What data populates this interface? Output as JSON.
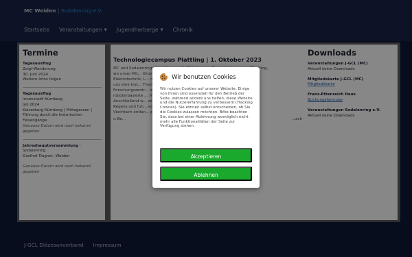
{
  "header": {
    "brand_main": "MC Weiden",
    "brand_sep": "|",
    "brand_sub": "Sodalenring e.V.",
    "nav": [
      {
        "label": "Startseite"
      },
      {
        "label": "Veranstaltungen"
      },
      {
        "label": "Jugendherberge"
      },
      {
        "label": "Chronik"
      }
    ]
  },
  "termine": {
    "title": "Termine",
    "events": [
      {
        "title": "Tagesausflug",
        "lines": [
          "Zoigl-Wanderung",
          "30. Juni 2024",
          "Weitere Infos folgen"
        ]
      },
      {
        "title": "Tagesausflug",
        "lines": [
          "Innenstadt Nürnberg",
          "Juli 2024",
          "Kaiserburg Nürnberg | Mittagessen | Führung durch die historischen Felsengänge"
        ],
        "note": "Genaues Datum wird noch bekannt gegeben"
      },
      {
        "title": "Jahreshauptversammlung",
        "title_suffix": "- Sodalenring",
        "lines": [
          "Gasthof Dagner, Weiden"
        ],
        "note": "Genaues Datum wird noch bekannt gegeben"
      }
    ]
  },
  "article": {
    "title": "Technologiecampus Plattling | 1. Oktober 2023",
    "body_lines": [
      "MC und Sodalenring besuchten am 1. Oktober den Technologiecampus Plattling,",
      "wo unser Mit...                                                    Grundlagen der",
      "Elektrotechnik, L...                                              nnhat. Otto hat",
      "uns eine Inst...                                                   Themen des",
      "Forschungszentr...                                              lektrische LKW,",
      "roboterbasierte ...                                               rhen) gegeben.",
      "Anschließend w...                                                 wir entlang des",
      "Regens und fuh...                                                 ecke Gotteszell-",
      "Viechtach entlan...                                               punkt."
    ],
    "img_left": "Be...",
    "img_right": "...ach"
  },
  "downloads": {
    "title": "Downloads",
    "sections": [
      {
        "title": "Veranstaltungen J-GCL (MC)",
        "text": "Aktuell keine Downloads"
      },
      {
        "title": "Mitgliedskarte J-GCL (MC)",
        "link": "Mitgliedskarte"
      },
      {
        "title": "Franz-Ettenreich Haus",
        "link": "Buchungsformular"
      },
      {
        "title": "Veranstaltungen Sodalenring e.V.",
        "text": "Aktuell keine Downloads"
      }
    ]
  },
  "cookie": {
    "title": "Wir benutzen Cookies",
    "text": "Wir nutzen Cookies auf unserer Website. Einige von ihnen sind essenziell für den Betrieb der Seite, während andere uns helfen, diese Website und die Nutzererfahrung zu verbessern (Tracking Cookies). Sie können selbst entscheiden, ob Sie die Cookies zulassen möchten. Bitte beachten Sie, dass bei einer Ablehnung womöglich nicht mehr alle Funktionalitäten der Seite zur Verfügung stehen.",
    "accept": "Akzeptieren",
    "decline": "Ablehnen",
    "button_color": "#1aa92c"
  },
  "footer": {
    "links": [
      {
        "label": "J-GCL Diözesanverband"
      },
      {
        "label": "Impressum"
      }
    ]
  }
}
